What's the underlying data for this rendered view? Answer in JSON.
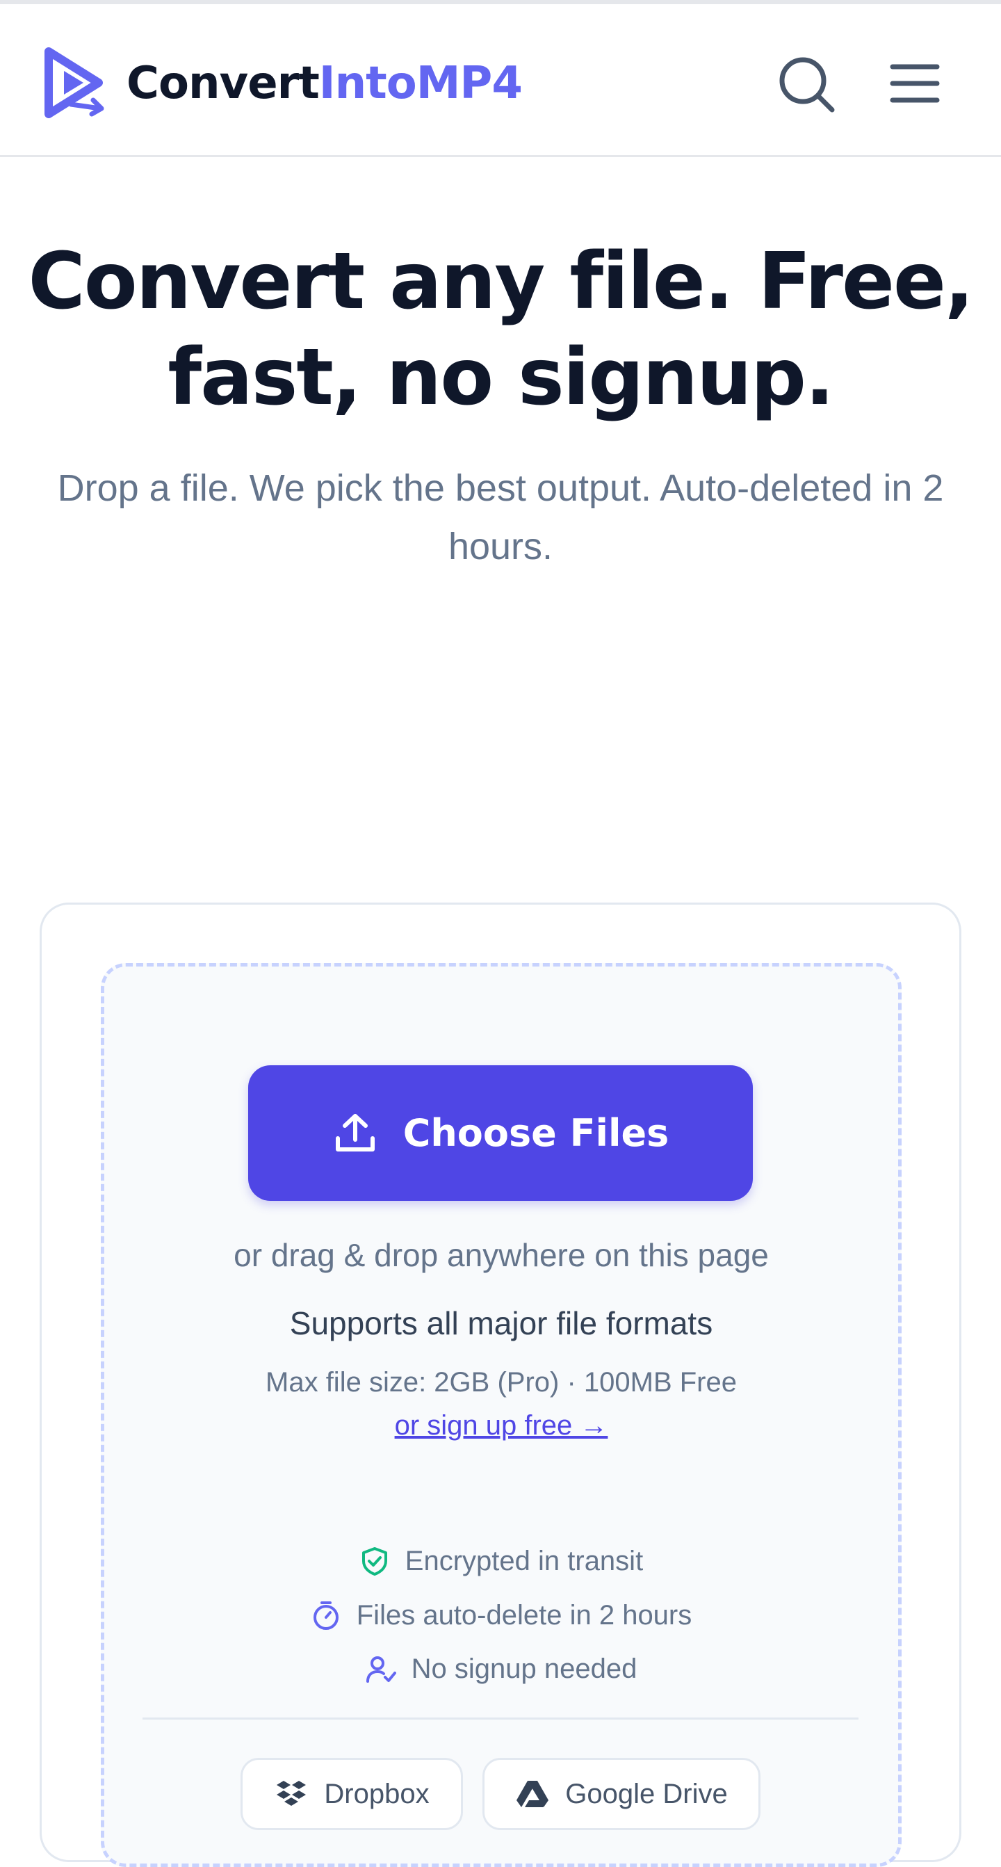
{
  "header": {
    "logo_icon": "play-arrow-logo-icon",
    "brand_part1": "Convert",
    "brand_part2": "IntoMP4",
    "search_icon": "search-icon",
    "menu_icon": "hamburger-menu-icon"
  },
  "hero": {
    "title": "Convert any file. Free, fast, no signup.",
    "subtitle": "Drop a file. We pick the best output. Auto-deleted in 2 hours."
  },
  "upload": {
    "button_label": "Choose Files",
    "button_icon": "upload-icon",
    "drag_hint": "or drag & drop anywhere on this page",
    "formats_note": "Supports all major file formats",
    "max_size": "Max file size: 2GB (Pro) · 100MB Free",
    "signup_link": "or sign up free →"
  },
  "features": [
    {
      "icon": "shield-check-icon",
      "label": "Encrypted in transit"
    },
    {
      "icon": "timer-icon",
      "label": "Files auto-delete in 2 hours"
    },
    {
      "icon": "user-check-icon",
      "label": "No signup needed"
    }
  ],
  "sources": [
    {
      "icon": "dropbox-icon",
      "label": "Dropbox"
    },
    {
      "icon": "google-drive-icon",
      "label": "Google Drive"
    }
  ],
  "colors": {
    "brand_accent": "#6366f1",
    "button_primary": "#4f46e5",
    "heading": "#0f172a",
    "muted_text": "#64748b",
    "secure_green": "#10b981",
    "dropzone_border": "#c7d2fe"
  }
}
